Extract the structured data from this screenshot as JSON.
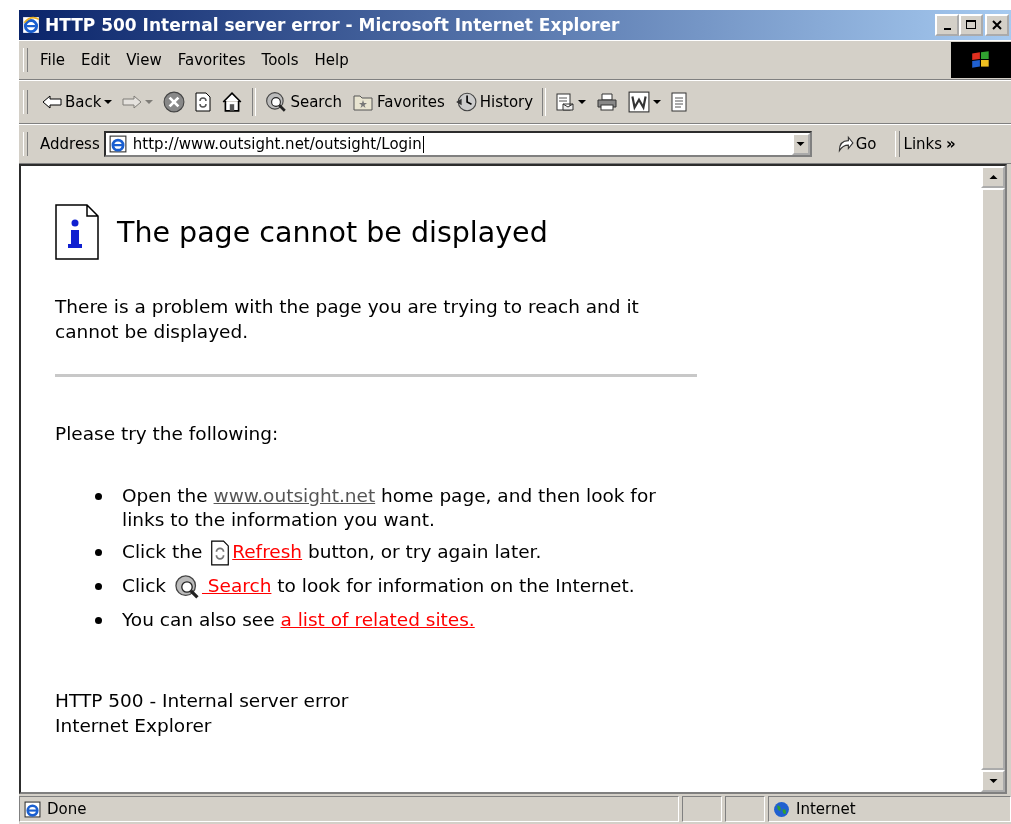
{
  "window": {
    "title": "HTTP 500 Internal server error - Microsoft Internet Explorer"
  },
  "menu": [
    "File",
    "Edit",
    "View",
    "Favorites",
    "Tools",
    "Help"
  ],
  "toolbar": [
    {
      "kind": "back",
      "label": "Back",
      "disabled": false,
      "dropdown": true
    },
    {
      "kind": "forward",
      "disabled": true,
      "dropdown": true
    },
    {
      "kind": "stop",
      "disabled": false,
      "dropdown": false
    },
    {
      "kind": "refresh",
      "disabled": false,
      "dropdown": false
    },
    {
      "kind": "home",
      "disabled": false,
      "dropdown": false
    },
    {
      "kind": "separator"
    },
    {
      "kind": "search",
      "label": "Search",
      "disabled": false,
      "dropdown": false
    },
    {
      "kind": "favorites",
      "label": "Favorites",
      "disabled": false,
      "dropdown": false
    },
    {
      "kind": "history",
      "label": "History",
      "disabled": false,
      "dropdown": false
    },
    {
      "kind": "separator"
    },
    {
      "kind": "mail",
      "disabled": false,
      "dropdown": true
    },
    {
      "kind": "print",
      "disabled": false,
      "dropdown": false
    },
    {
      "kind": "word",
      "disabled": false,
      "dropdown": true
    },
    {
      "kind": "notes",
      "disabled": false,
      "dropdown": false
    }
  ],
  "address": {
    "label": "Address",
    "value": "http://www.outsight.net/outsight/Login",
    "go": "Go",
    "links": "Links",
    "more": "»"
  },
  "page": {
    "heading": "The page cannot be displayed",
    "intro": "There is a problem with the page you are trying to reach and it cannot be displayed.",
    "prompt": "Please try the following:",
    "items": [
      [
        {
          "kind": "text",
          "text": "Open the "
        },
        {
          "kind": "visited-link",
          "text": "www.outsight.net"
        },
        {
          "kind": "text",
          "text": " home page, and then look for links to the information you want."
        }
      ],
      [
        {
          "kind": "text",
          "text": "Click the "
        },
        {
          "kind": "refresh-icon"
        },
        {
          "kind": "link",
          "text": "Refresh"
        },
        {
          "kind": "text",
          "text": " button, or try again later."
        }
      ],
      [
        {
          "kind": "text",
          "text": "Click "
        },
        {
          "kind": "search-icon"
        },
        {
          "kind": "link",
          "text": " Search"
        },
        {
          "kind": "text",
          "text": " to look for information on the Internet."
        }
      ],
      [
        {
          "kind": "text",
          "text": "You can also see "
        },
        {
          "kind": "link",
          "text": "a list of related sites."
        }
      ]
    ],
    "footer": [
      "HTTP 500 - Internal server error",
      "Internet Explorer"
    ]
  },
  "status": {
    "text": "Done",
    "zone": "Internet"
  }
}
